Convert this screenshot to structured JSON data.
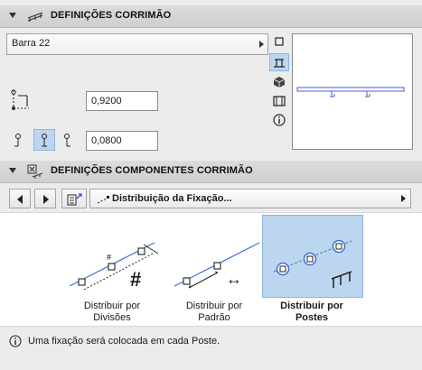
{
  "rail_settings": {
    "title": "DEFINIÇÕES CORRIMÃO",
    "profile_name": "Barra 22",
    "offset_value": "0,9200",
    "spacing_value": "0,0800"
  },
  "components": {
    "title": "DEFINIÇÕES COMPONENTES CORRIMÃO",
    "dropdown_label": "Distribuição da Fixação..."
  },
  "distribution": {
    "options": [
      {
        "line1": "Distribuir por",
        "line2": "Divisões",
        "selected": false
      },
      {
        "line1": "Distribuir por",
        "line2": "Padrão",
        "selected": false
      },
      {
        "line1": "Distribuir por",
        "line2": "Postes",
        "selected": true
      }
    ]
  },
  "info_text": "Uma fixação será colocada em cada Poste.",
  "colors": {
    "accent_blue": "#3f6fd8",
    "selected_bg": "#bcd6ef"
  }
}
